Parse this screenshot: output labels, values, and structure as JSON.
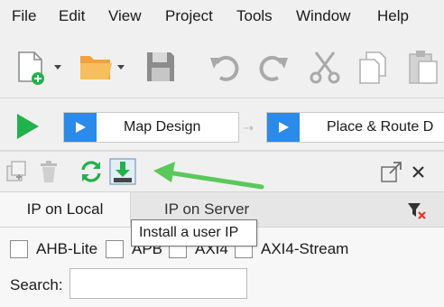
{
  "menubar": {
    "items": [
      "File",
      "Edit",
      "View",
      "Project",
      "Tools",
      "Window",
      "Help"
    ]
  },
  "toolbar": {
    "icons": [
      "new-file-icon",
      "open-folder-icon",
      "save-icon",
      "undo-icon",
      "redo-icon",
      "cut-icon",
      "copy-icon",
      "paste-icon"
    ]
  },
  "flow": {
    "steps": [
      {
        "label": "Map Design"
      },
      {
        "label": "Place & Route D"
      }
    ]
  },
  "ip_panel": {
    "tools": [
      "ip-add-icon",
      "delete-icon",
      "refresh-icon",
      "install-ip-icon",
      "undock-icon",
      "close-icon"
    ],
    "tabs": [
      "IP on Local",
      "IP on Server"
    ],
    "tooltip": "Install a user IP",
    "filters": [
      {
        "label": "AHB-Lite",
        "checked": false
      },
      {
        "label": "APB",
        "checked": false
      },
      {
        "label": "AXI4",
        "checked": false
      },
      {
        "label": "AXI4-Stream",
        "checked": false
      }
    ],
    "search_label": "Search:",
    "search_value": ""
  },
  "colors": {
    "run_green": "#22b24c",
    "step_blue": "#2c8ae8",
    "annotation_green": "#5ac85a",
    "folder_orange": "#f0a23c"
  }
}
